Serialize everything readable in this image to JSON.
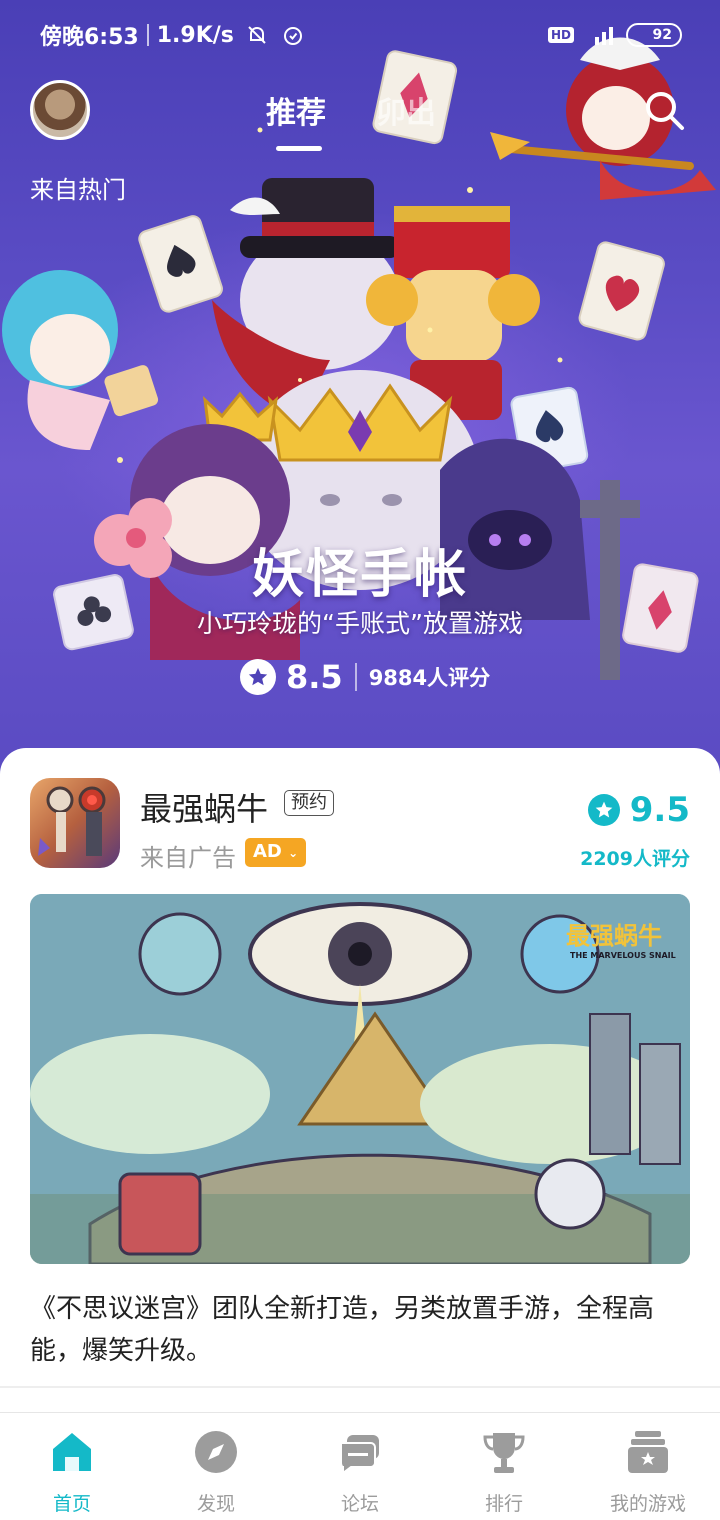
{
  "status_bar": {
    "time": "傍晚6:53",
    "speed": "1.9K/s",
    "hd": "HD",
    "battery": "92"
  },
  "header": {
    "tabs": [
      {
        "label": "推荐",
        "active": true
      },
      {
        "label": "卯出",
        "active": false
      }
    ],
    "source_label": "来自热门"
  },
  "hero": {
    "title": "妖怪手帐",
    "subtitle": "小巧玲珑的“手账式”放置游戏",
    "score": "8.5",
    "rating_count": "9884人评分"
  },
  "card": {
    "app_name": "最强蜗牛",
    "reserve_badge": "预约",
    "source": "来自广告",
    "ad_badge": "AD",
    "score": "9.5",
    "rating_count": "2209人评分",
    "banner_logo_cn": "最强蜗牛",
    "banner_logo_en": "THE MARVELOUS SNAIL",
    "description": "《不思议迷宫》团队全新打造，另类放置手游，全程高能，爆笑升级。"
  },
  "bottom_nav": {
    "items": [
      {
        "label": "首页",
        "icon": "home-icon",
        "active": true
      },
      {
        "label": "发现",
        "icon": "compass-icon",
        "active": false
      },
      {
        "label": "论坛",
        "icon": "forum-icon",
        "active": false
      },
      {
        "label": "排行",
        "icon": "trophy-icon",
        "active": false
      },
      {
        "label": "我的游戏",
        "icon": "my-games-icon",
        "active": false
      }
    ]
  },
  "colors": {
    "accent": "#14b9c8",
    "hero_bg": "#5a4cc4",
    "ad_badge": "#f5a623"
  }
}
